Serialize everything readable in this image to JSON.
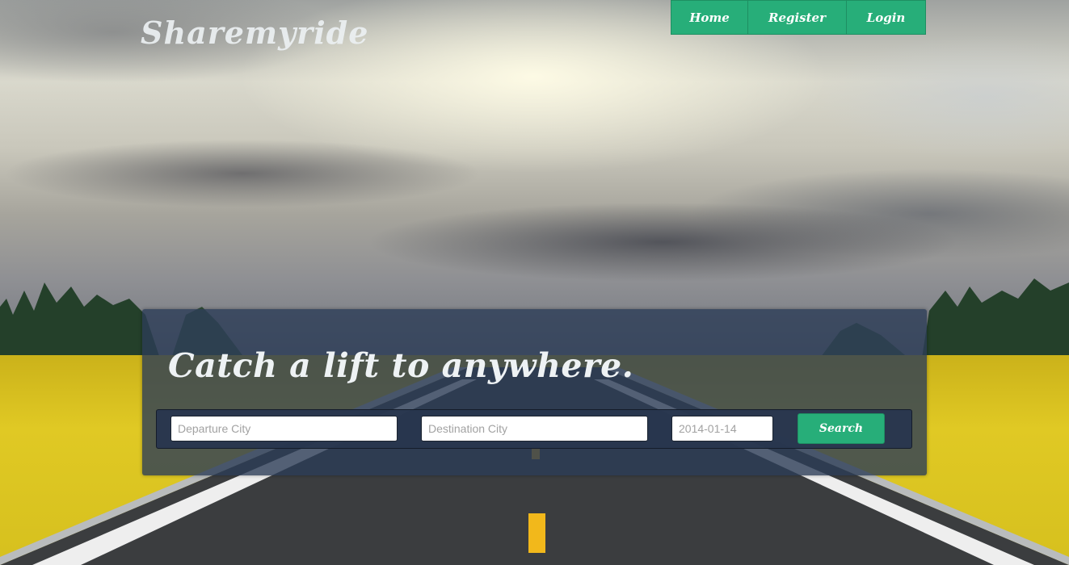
{
  "brand": {
    "name": "Sharemyride"
  },
  "nav": {
    "items": [
      {
        "label": "Home"
      },
      {
        "label": "Register"
      },
      {
        "label": "Login"
      }
    ]
  },
  "hero": {
    "headline": "Catch a lift to anywhere."
  },
  "search": {
    "departure_placeholder": "Departure City",
    "destination_placeholder": "Destination City",
    "date_value": "",
    "date_placeholder": "2014-01-14",
    "button_label": "Search"
  },
  "colors": {
    "accent": "#27ae79",
    "panel": "#2c3c56"
  }
}
